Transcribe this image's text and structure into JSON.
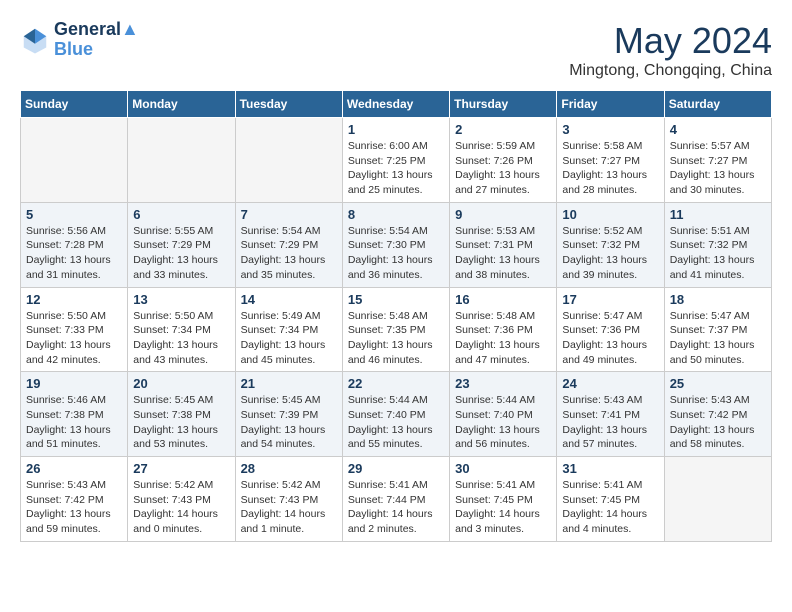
{
  "logo": {
    "line1": "General",
    "line2": "Blue"
  },
  "title": "May 2024",
  "subtitle": "Mingtong, Chongqing, China",
  "headers": [
    "Sunday",
    "Monday",
    "Tuesday",
    "Wednesday",
    "Thursday",
    "Friday",
    "Saturday"
  ],
  "weeks": [
    [
      {
        "day": "",
        "info": ""
      },
      {
        "day": "",
        "info": ""
      },
      {
        "day": "",
        "info": ""
      },
      {
        "day": "1",
        "info": "Sunrise: 6:00 AM\nSunset: 7:25 PM\nDaylight: 13 hours\nand 25 minutes."
      },
      {
        "day": "2",
        "info": "Sunrise: 5:59 AM\nSunset: 7:26 PM\nDaylight: 13 hours\nand 27 minutes."
      },
      {
        "day": "3",
        "info": "Sunrise: 5:58 AM\nSunset: 7:27 PM\nDaylight: 13 hours\nand 28 minutes."
      },
      {
        "day": "4",
        "info": "Sunrise: 5:57 AM\nSunset: 7:27 PM\nDaylight: 13 hours\nand 30 minutes."
      }
    ],
    [
      {
        "day": "5",
        "info": "Sunrise: 5:56 AM\nSunset: 7:28 PM\nDaylight: 13 hours\nand 31 minutes."
      },
      {
        "day": "6",
        "info": "Sunrise: 5:55 AM\nSunset: 7:29 PM\nDaylight: 13 hours\nand 33 minutes."
      },
      {
        "day": "7",
        "info": "Sunrise: 5:54 AM\nSunset: 7:29 PM\nDaylight: 13 hours\nand 35 minutes."
      },
      {
        "day": "8",
        "info": "Sunrise: 5:54 AM\nSunset: 7:30 PM\nDaylight: 13 hours\nand 36 minutes."
      },
      {
        "day": "9",
        "info": "Sunrise: 5:53 AM\nSunset: 7:31 PM\nDaylight: 13 hours\nand 38 minutes."
      },
      {
        "day": "10",
        "info": "Sunrise: 5:52 AM\nSunset: 7:32 PM\nDaylight: 13 hours\nand 39 minutes."
      },
      {
        "day": "11",
        "info": "Sunrise: 5:51 AM\nSunset: 7:32 PM\nDaylight: 13 hours\nand 41 minutes."
      }
    ],
    [
      {
        "day": "12",
        "info": "Sunrise: 5:50 AM\nSunset: 7:33 PM\nDaylight: 13 hours\nand 42 minutes."
      },
      {
        "day": "13",
        "info": "Sunrise: 5:50 AM\nSunset: 7:34 PM\nDaylight: 13 hours\nand 43 minutes."
      },
      {
        "day": "14",
        "info": "Sunrise: 5:49 AM\nSunset: 7:34 PM\nDaylight: 13 hours\nand 45 minutes."
      },
      {
        "day": "15",
        "info": "Sunrise: 5:48 AM\nSunset: 7:35 PM\nDaylight: 13 hours\nand 46 minutes."
      },
      {
        "day": "16",
        "info": "Sunrise: 5:48 AM\nSunset: 7:36 PM\nDaylight: 13 hours\nand 47 minutes."
      },
      {
        "day": "17",
        "info": "Sunrise: 5:47 AM\nSunset: 7:36 PM\nDaylight: 13 hours\nand 49 minutes."
      },
      {
        "day": "18",
        "info": "Sunrise: 5:47 AM\nSunset: 7:37 PM\nDaylight: 13 hours\nand 50 minutes."
      }
    ],
    [
      {
        "day": "19",
        "info": "Sunrise: 5:46 AM\nSunset: 7:38 PM\nDaylight: 13 hours\nand 51 minutes."
      },
      {
        "day": "20",
        "info": "Sunrise: 5:45 AM\nSunset: 7:38 PM\nDaylight: 13 hours\nand 53 minutes."
      },
      {
        "day": "21",
        "info": "Sunrise: 5:45 AM\nSunset: 7:39 PM\nDaylight: 13 hours\nand 54 minutes."
      },
      {
        "day": "22",
        "info": "Sunrise: 5:44 AM\nSunset: 7:40 PM\nDaylight: 13 hours\nand 55 minutes."
      },
      {
        "day": "23",
        "info": "Sunrise: 5:44 AM\nSunset: 7:40 PM\nDaylight: 13 hours\nand 56 minutes."
      },
      {
        "day": "24",
        "info": "Sunrise: 5:43 AM\nSunset: 7:41 PM\nDaylight: 13 hours\nand 57 minutes."
      },
      {
        "day": "25",
        "info": "Sunrise: 5:43 AM\nSunset: 7:42 PM\nDaylight: 13 hours\nand 58 minutes."
      }
    ],
    [
      {
        "day": "26",
        "info": "Sunrise: 5:43 AM\nSunset: 7:42 PM\nDaylight: 13 hours\nand 59 minutes."
      },
      {
        "day": "27",
        "info": "Sunrise: 5:42 AM\nSunset: 7:43 PM\nDaylight: 14 hours\nand 0 minutes."
      },
      {
        "day": "28",
        "info": "Sunrise: 5:42 AM\nSunset: 7:43 PM\nDaylight: 14 hours\nand 1 minute."
      },
      {
        "day": "29",
        "info": "Sunrise: 5:41 AM\nSunset: 7:44 PM\nDaylight: 14 hours\nand 2 minutes."
      },
      {
        "day": "30",
        "info": "Sunrise: 5:41 AM\nSunset: 7:45 PM\nDaylight: 14 hours\nand 3 minutes."
      },
      {
        "day": "31",
        "info": "Sunrise: 5:41 AM\nSunset: 7:45 PM\nDaylight: 14 hours\nand 4 minutes."
      },
      {
        "day": "",
        "info": ""
      }
    ]
  ]
}
